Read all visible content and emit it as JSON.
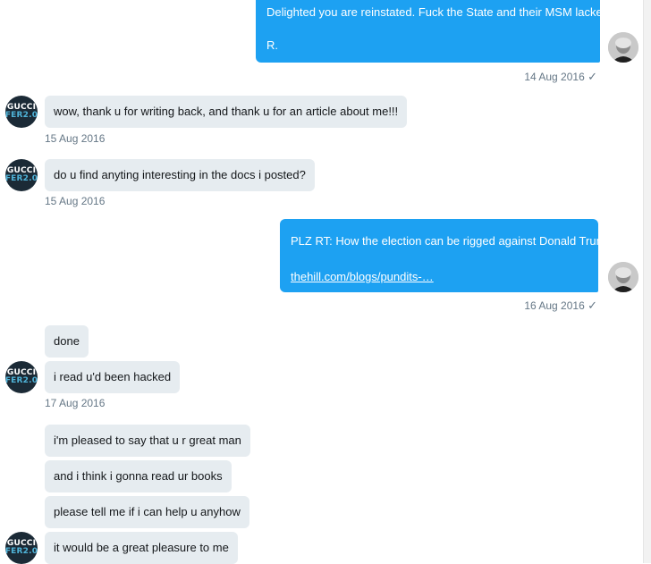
{
  "conversation": {
    "msg1": {
      "line1": "Delighted you are reinstated. Fuck the State and their MSM lackeys",
      "line2": "R.",
      "time": "14 Aug 2016",
      "check": "✓"
    },
    "msg2": {
      "text": "wow, thank u for writing back, and thank u for an article about me!!!",
      "time": "15 Aug 2016"
    },
    "msg3": {
      "text": "do u find anyting interesting in the docs i posted?",
      "time": "15 Aug 2016"
    },
    "msg4": {
      "line1": "PLZ RT: How the election can be rigged against Donald Trump",
      "link": "thehill.com/blogs/pundits-…",
      "time": "16 Aug 2016",
      "check": "✓"
    },
    "group1": {
      "items": [
        "done",
        "i read u'd been hacked"
      ],
      "time": "17 Aug 2016"
    },
    "group2": {
      "items": [
        "i'm pleased to say that u r great man",
        "and i think i gonna read ur books",
        "please tell me if i can help u anyhow",
        "it would be a great pleasure to me"
      ]
    }
  },
  "avatar": {
    "gucci_line1": "GUCCI",
    "gucci_line2": "FER2.0"
  },
  "colors": {
    "outgoing": "#1da1f2",
    "incoming": "#e6ecf0",
    "timestamp": "#657786"
  }
}
